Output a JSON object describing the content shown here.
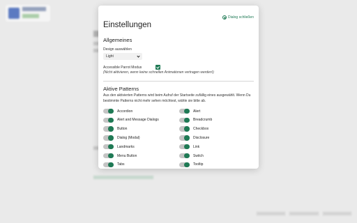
{
  "dialog": {
    "title": "Einstellungen",
    "close_label": "Dialog schließen"
  },
  "general": {
    "heading": "Allgemeines",
    "design_label": "Design auswählen",
    "design_value": "Light",
    "parrot_label": "Accessible Parrot Modus",
    "parrot_checked": true,
    "parrot_hint": "(Nicht aktivieren, wenn keine schnellen Animationen vertragen werden!)"
  },
  "active_patterns": {
    "heading": "Aktive Patterns",
    "description": "Aus den aktivierten Patterns wird beim Aufruf der Startseite zufällig eines ausgewählt. Wenn Du bestimmte Patterns nicht mehr sehen möchtest, wähle sie bitte ab.",
    "left": [
      {
        "label": "Accordion",
        "on": true
      },
      {
        "label": "Alert and Message Dialogs",
        "on": true
      },
      {
        "label": "Button",
        "on": true
      },
      {
        "label": "Dialog (Modal)",
        "on": true
      },
      {
        "label": "Landmarks",
        "on": true
      },
      {
        "label": "Menu Button",
        "on": true
      },
      {
        "label": "Tabs",
        "on": true
      }
    ],
    "right": [
      {
        "label": "Alert",
        "on": true
      },
      {
        "label": "Breadcrumb",
        "on": true
      },
      {
        "label": "Checkbox",
        "on": true
      },
      {
        "label": "Disclosure",
        "on": true
      },
      {
        "label": "Link",
        "on": true
      },
      {
        "label": "Switch",
        "on": true
      },
      {
        "label": "Tooltip",
        "on": true
      }
    ]
  },
  "colors": {
    "accent": "#1f7a55",
    "toggle_track": "#c4c4c4"
  }
}
